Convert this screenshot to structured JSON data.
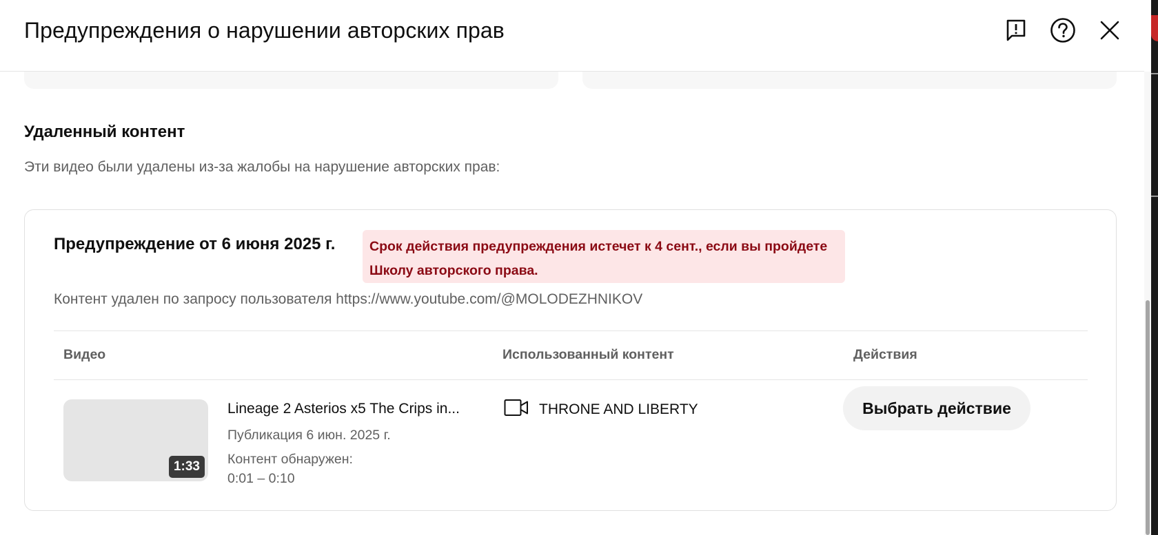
{
  "dialog": {
    "title": "Предупреждения о нарушении авторских прав",
    "icons": [
      "feedback-icon",
      "help-icon",
      "close-icon"
    ]
  },
  "removed_section": {
    "title": "Удаленный контент",
    "description": "Эти видео были удалены из-за жалобы на нарушение авторских прав:"
  },
  "strike": {
    "title": "Предупреждение от 6 июня 2025 г.",
    "expiry_notice": "Срок действия предупреждения истечет к 4 сент., если вы пройдете Школу авторского права.",
    "reason": "Контент удален по запросу пользователя https://www.youtube.com/@MOLODEZHNIKOV",
    "table": {
      "columns": [
        "Видео",
        "Использованный контент",
        "Действия"
      ],
      "rows": [
        {
          "video_title": "Lineage 2 Asterios x5 The Crips in...",
          "duration": "1:33",
          "published": "Публикация 6 июн. 2025 г.",
          "detected_label": "Контент обнаружен:",
          "detected_range": "0:01 – 0:10",
          "content_icon": "video-camera-icon",
          "content_name": "THRONE AND LIBERTY",
          "action_label": "Выбрать действие"
        }
      ]
    }
  },
  "colors": {
    "badge_bg": "#fde6e7",
    "badge_text": "#8b0a14",
    "secondary_text": "#606060",
    "button_bg": "#f2f2f2"
  }
}
